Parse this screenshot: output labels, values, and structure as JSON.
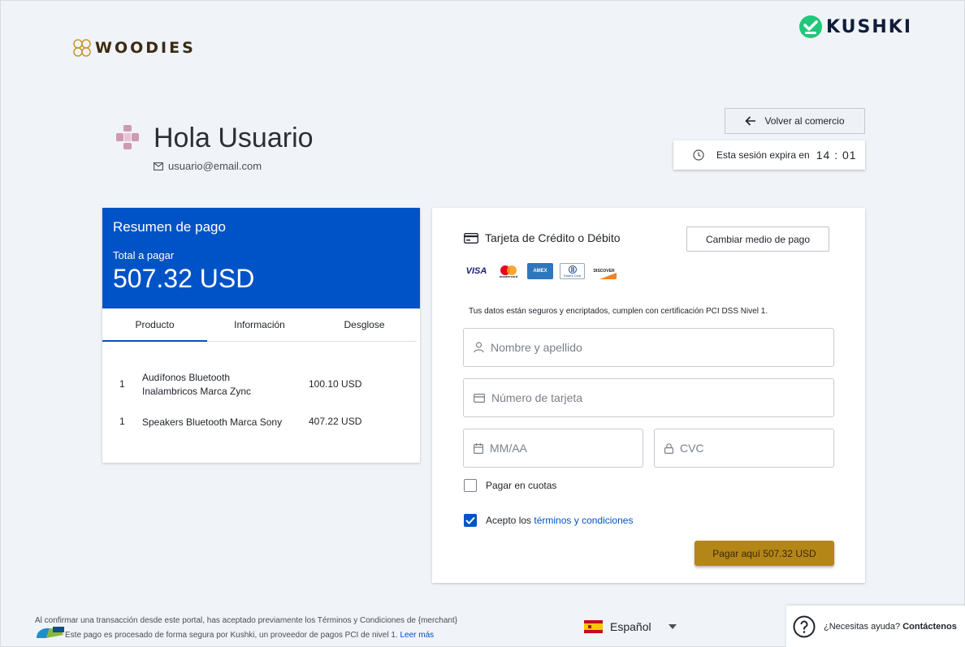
{
  "brand": {
    "merchant_logo_text": "WOODIES",
    "provider_logo_text": "KUSHKI"
  },
  "user": {
    "greeting": "Hola Usuario",
    "email": "usuario@email.com"
  },
  "header": {
    "back_label": "Volver al comercio",
    "session_label": "Esta sesión expira en",
    "session_time": "14 : 01"
  },
  "summary": {
    "title": "Resumen de pago",
    "total_label": "Total a pagar",
    "total": "507.32 USD",
    "tabs": [
      {
        "label": "Producto",
        "active": true
      },
      {
        "label": "Información",
        "active": false
      },
      {
        "label": "Desglose",
        "active": false
      }
    ],
    "products": [
      {
        "qty": "1",
        "name": "Audífonos Bluetooth Inalambricos Marca Zync",
        "price": "100.10 USD"
      },
      {
        "qty": "1",
        "name": "Speakers Bluetooth Marca Sony",
        "price": "407.22 USD"
      }
    ]
  },
  "payment": {
    "method_title": "Tarjeta de Crédito o Débito",
    "change_label": "Cambiar medio de pago",
    "card_brands": [
      "VISA",
      "mastercard",
      "AMEX",
      "Diners Club",
      "DISCOVER"
    ],
    "secure_note": "Tus datos están seguros y encriptados, cumplen con certificación PCI DSS Nivel 1.",
    "fields": {
      "name_placeholder": "Nombre y apellido",
      "card_placeholder": "Número de tarjeta",
      "expiry_placeholder": "MM/AA",
      "cvc_placeholder": "CVC"
    },
    "installments_label": "Pagar en cuotas",
    "installments_checked": false,
    "terms_prefix": "Acepto los",
    "terms_link": "términos y condiciones",
    "terms_checked": true,
    "pay_label": "Pagar aquí 507.32 USD"
  },
  "footer": {
    "line1": "Al confirmar una transacción desde este portal, has aceptado previamente los Términos y Condiciones de {merchant}",
    "line2": "Este pago es procesado de forma segura por Kushki, un proveedor de pagos PCI de nivel 1.",
    "read_more": "Leer más",
    "language": "Español",
    "help_question": "¿Necesitas ayuda?",
    "help_contact": "Contáctenos"
  },
  "colors": {
    "primary": "#0053c7",
    "pay_button": "#b48618",
    "kushki_green": "#1fc87a"
  }
}
